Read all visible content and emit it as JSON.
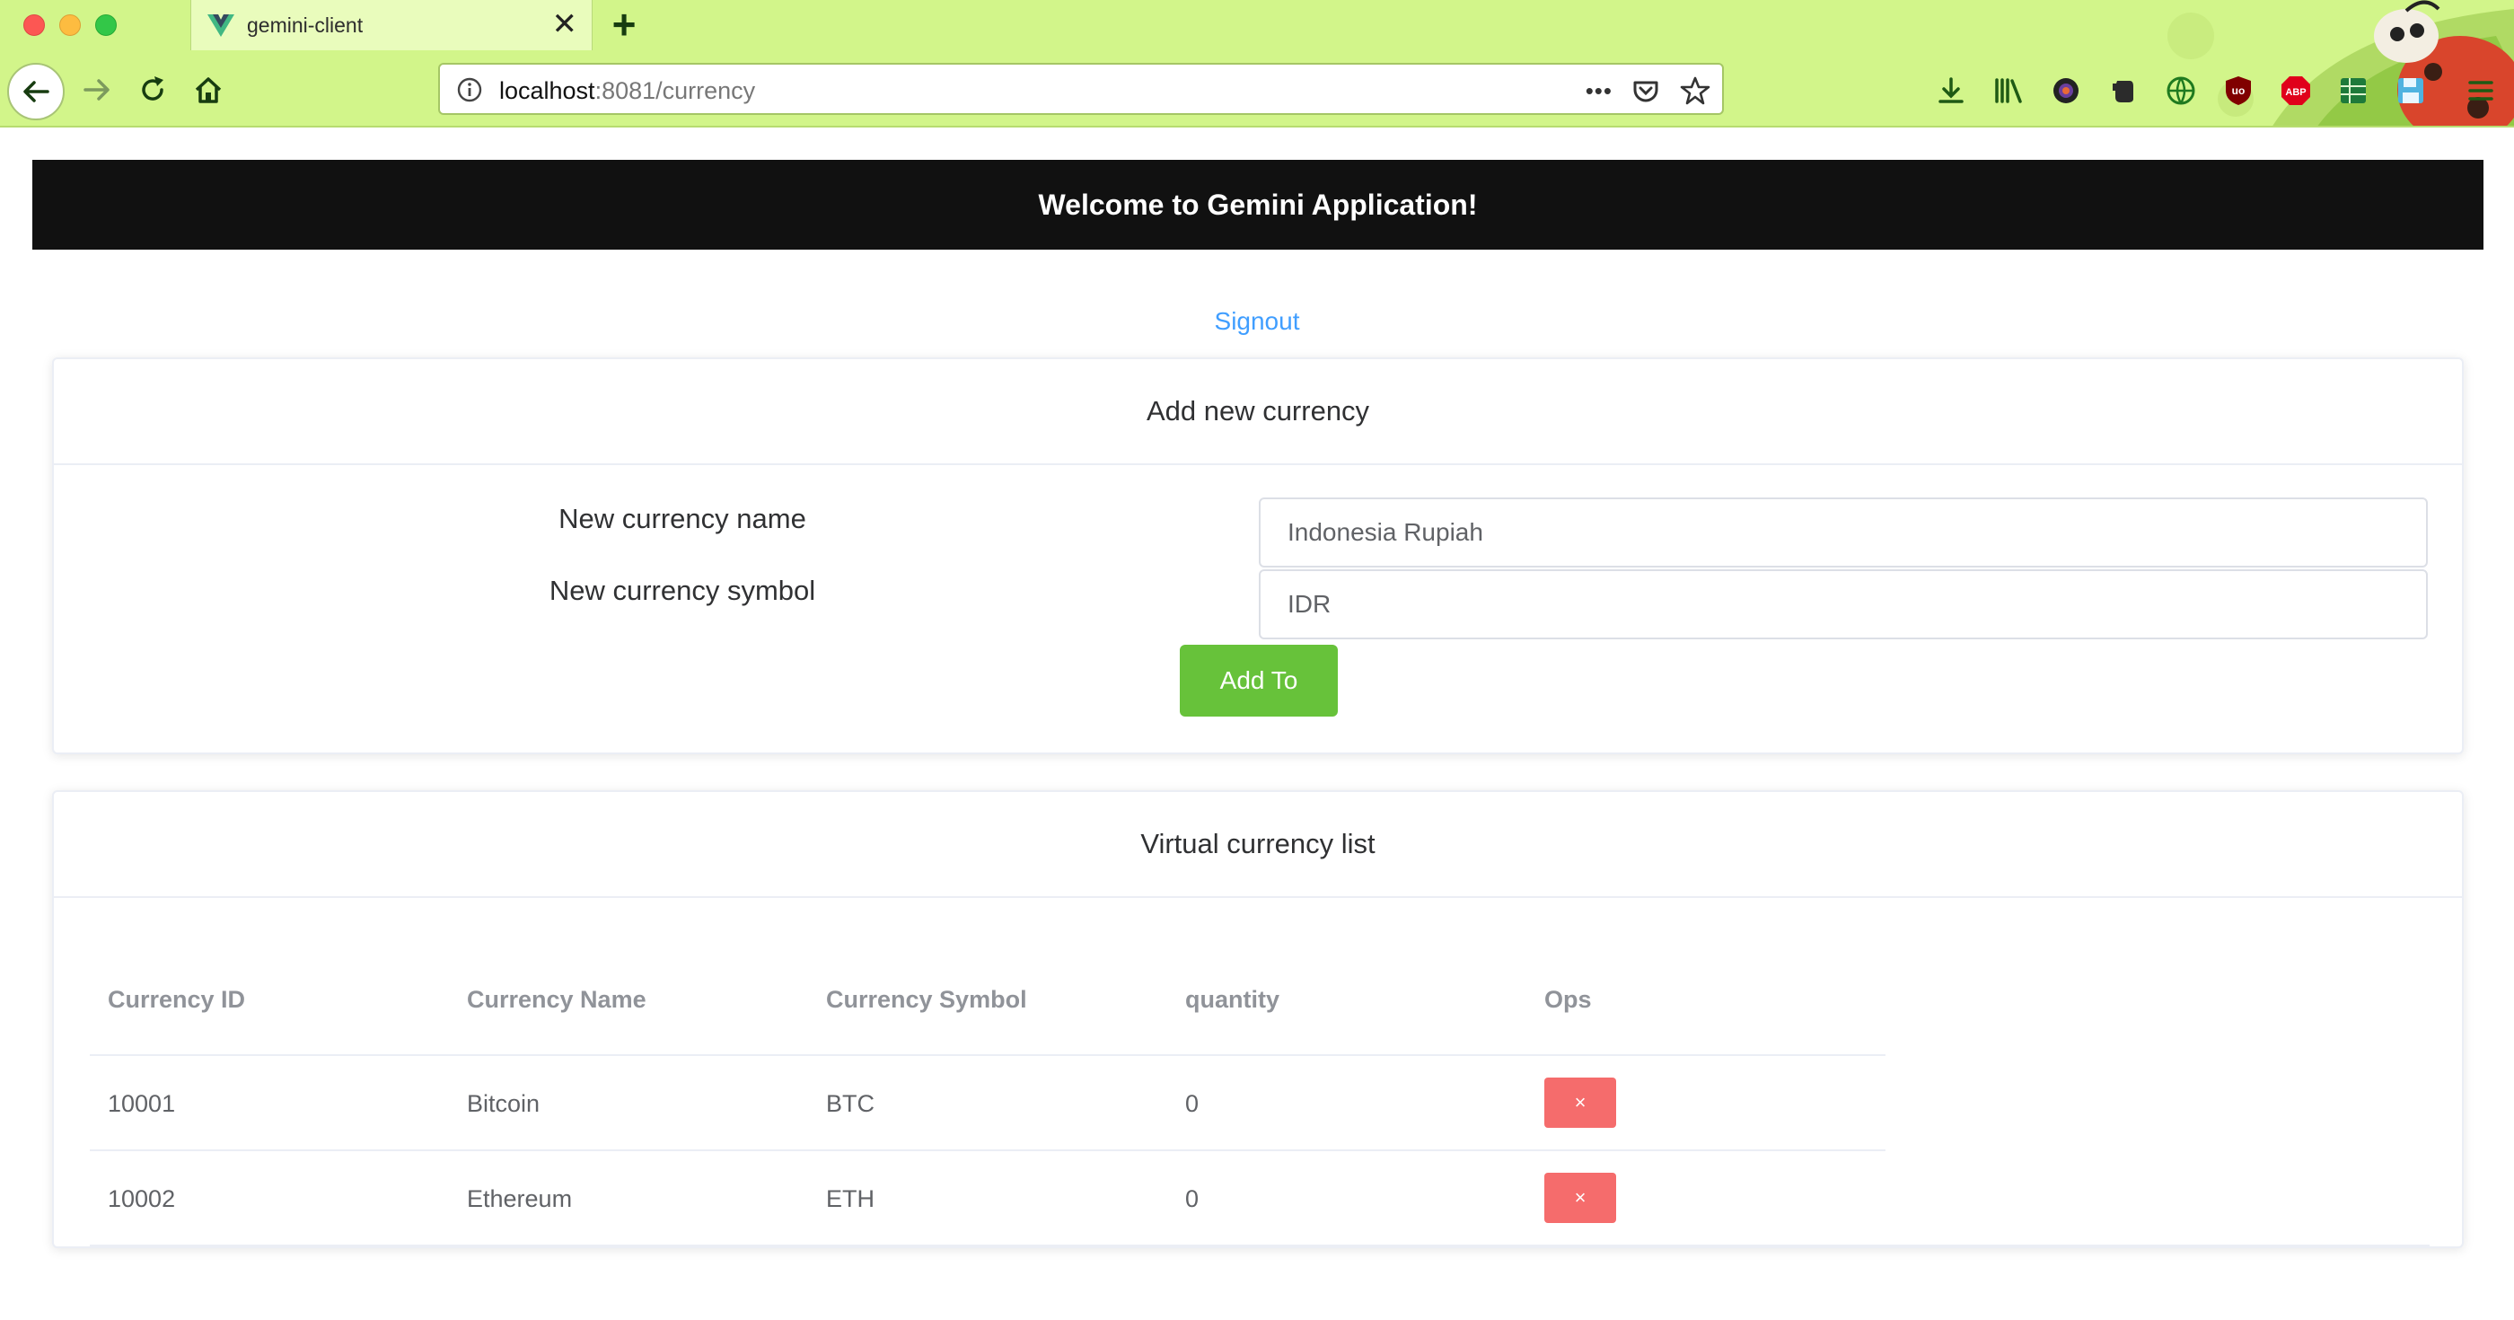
{
  "browser": {
    "tab_title": "gemini-client",
    "tab_close_glyph": "✕",
    "new_tab_glyph": "+",
    "url_host": "localhost",
    "url_rest": ":8081/currency",
    "url_more_glyph": "•••",
    "accent": "#d2f58a"
  },
  "header": {
    "title": "Welcome to Gemini Application!",
    "background": "#111111"
  },
  "auth": {
    "signout_label": "Signout"
  },
  "add_form": {
    "title": "Add new currency",
    "name_label": "New currency name",
    "symbol_label": "New currency symbol",
    "name_value": "Indonesia Rupiah",
    "symbol_value": "IDR",
    "submit_label": "Add To",
    "submit_color": "#67c23a"
  },
  "currency_list": {
    "title": "Virtual currency list",
    "columns": [
      "Currency ID",
      "Currency Name",
      "Currency Symbol",
      "quantity",
      "Ops"
    ],
    "rows": [
      {
        "id": "10001",
        "name": "Bitcoin",
        "symbol": "BTC",
        "quantity": "0",
        "delete_label": "×"
      },
      {
        "id": "10002",
        "name": "Ethereum",
        "symbol": "ETH",
        "quantity": "0",
        "delete_label": "×"
      }
    ],
    "delete_color": "#f56c6c"
  }
}
